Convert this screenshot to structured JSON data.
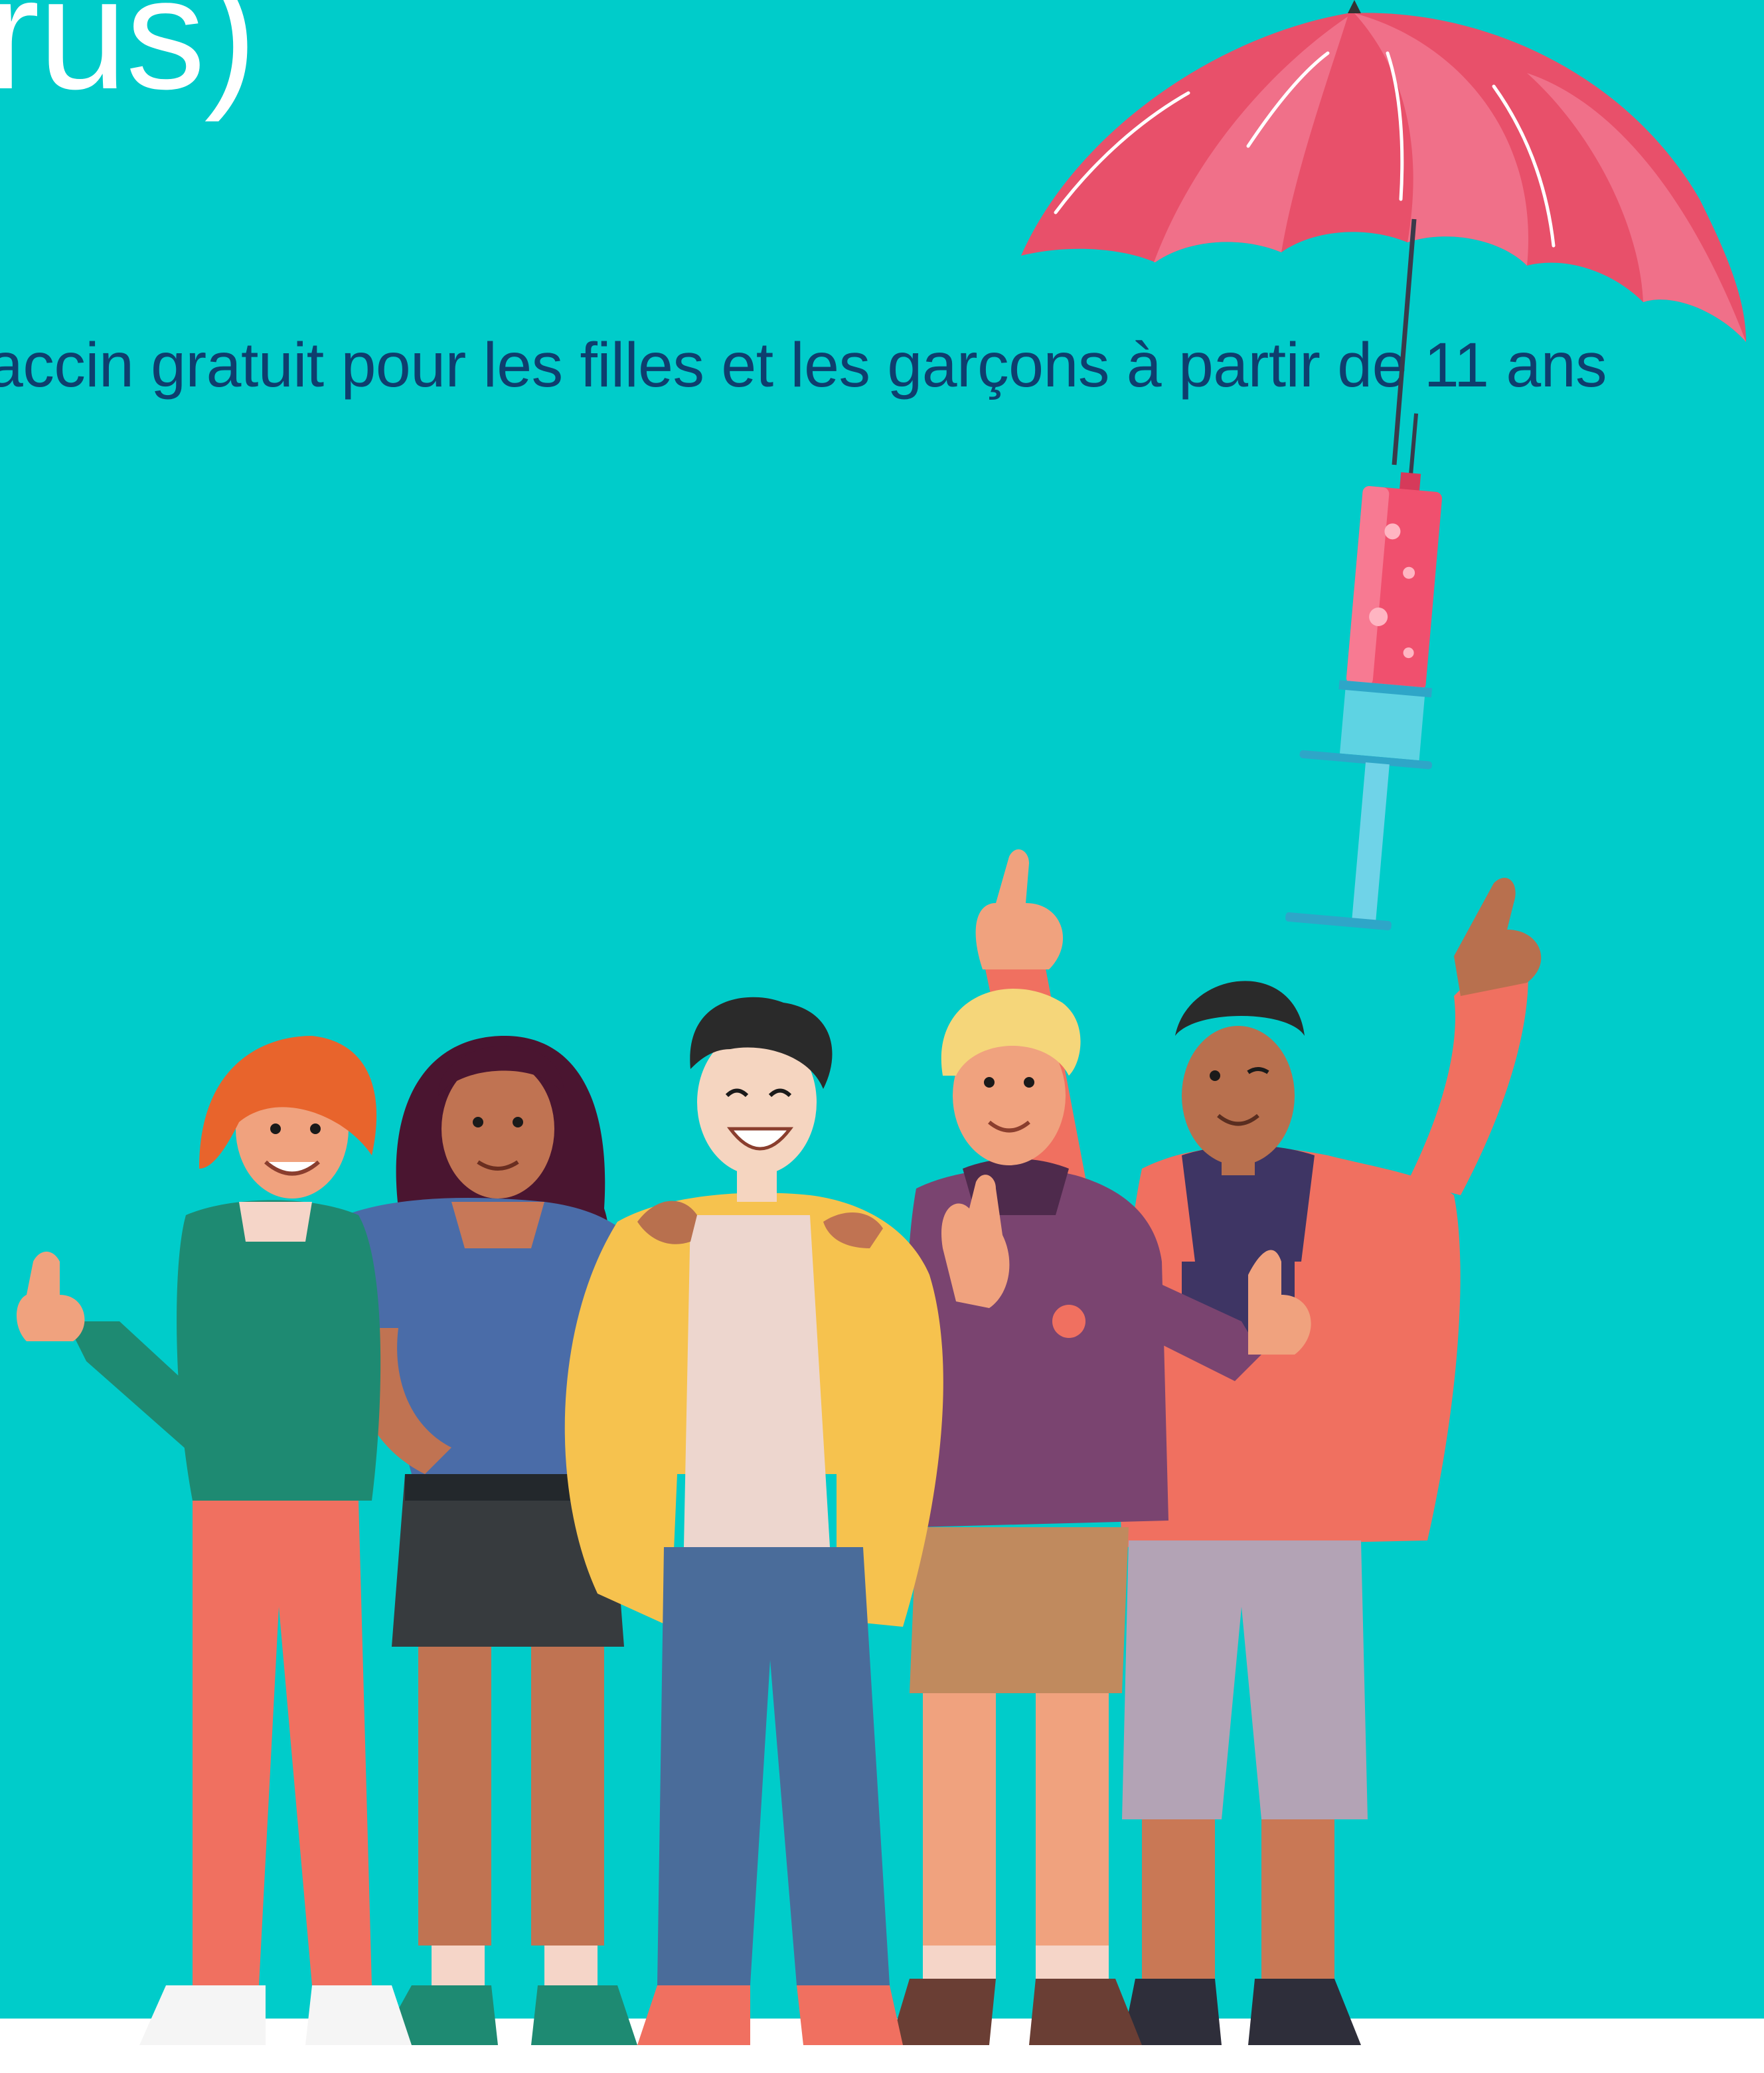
{
  "poster": {
    "title_fragment": "rus)",
    "subtitle": "accin gratuit pour les filles et les garçons à partir de 11 ans"
  },
  "colors": {
    "background": "#00CCCA",
    "title_text": "#FFFFFF",
    "subtitle_text": "#0E3E6E",
    "umbrella": "#E8506A",
    "syringe_liquid": "#F0506E",
    "floor": "#FFFFFF"
  },
  "illustration": {
    "objects": [
      "umbrella-icon",
      "syringe-icon"
    ],
    "people": [
      "person-red-hair-green-sweater",
      "person-curly-hair-blue-top",
      "person-yellow-jacket",
      "person-blond-purple-jacket",
      "person-pink-jacket-arm-raised"
    ]
  }
}
